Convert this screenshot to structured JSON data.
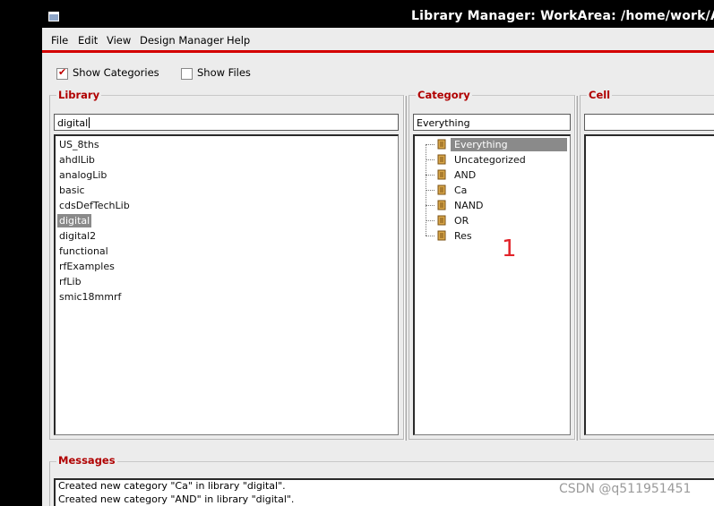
{
  "window": {
    "title": "Library Manager: WorkArea: /home/work/Ana"
  },
  "menu": [
    "File",
    "Edit",
    "View",
    "Design Manager",
    "Help"
  ],
  "options": {
    "show_categories": {
      "label": "Show Categories",
      "checked": true
    },
    "show_files": {
      "label": "Show Files",
      "checked": false
    }
  },
  "library": {
    "label": "Library",
    "filter_value": "digital",
    "items": [
      "US_8ths",
      "ahdlLib",
      "analogLib",
      "basic",
      "cdsDefTechLib",
      "digital",
      "digital2",
      "functional",
      "rfExamples",
      "rfLib",
      "smic18mmrf"
    ],
    "selected": "digital"
  },
  "category": {
    "label": "Category",
    "filter_value": "Everything",
    "items": [
      "Everything",
      "Uncategorized",
      "AND",
      "Ca",
      "NAND",
      "OR",
      "Res"
    ],
    "selected": "Everything",
    "icon": "scroll-icon"
  },
  "cell": {
    "label": "Cell",
    "filter_value": ""
  },
  "messages": {
    "label": "Messages",
    "lines": [
      "Created new category \"Ca\" in library \"digital\".",
      "Created new category \"AND\" in library \"digital\"."
    ]
  },
  "annotation": "1",
  "watermark": "CSDN @q511951451",
  "colors": {
    "accent": "#d40000",
    "label": "#b00000",
    "selection": "#8a8a8a",
    "annotation": "#e2242a"
  }
}
